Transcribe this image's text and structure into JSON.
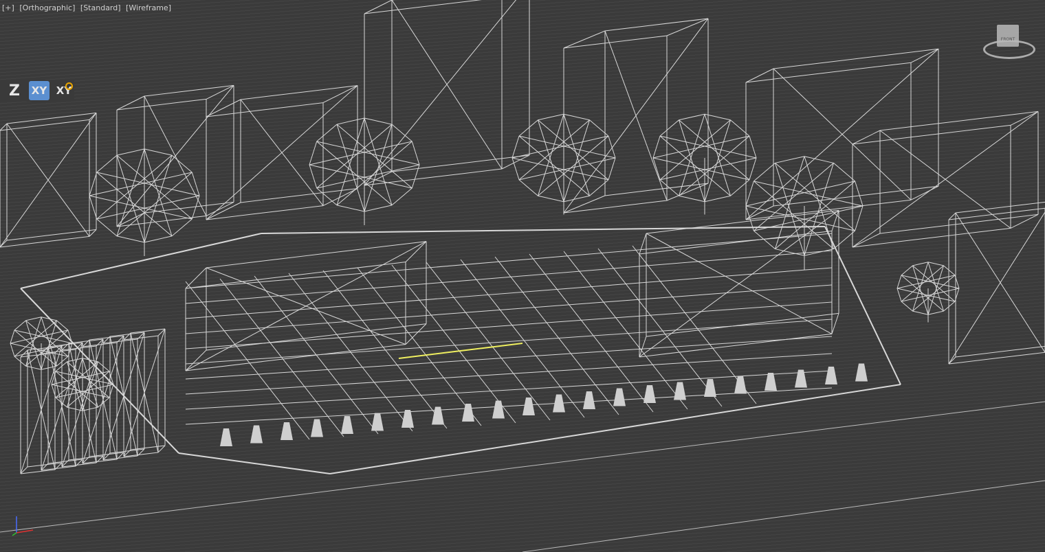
{
  "viewport": {
    "label_items": [
      "[+]",
      "[Orthographic]",
      "[Standard]",
      "[Wireframe]"
    ],
    "constraints": {
      "z": "Z",
      "xy": "XY",
      "xy_lock": "XY"
    },
    "viewcube_face": "FRONT",
    "colors": {
      "wire": "#d8d8d8",
      "selected": "#f0f060",
      "active": "#5b8fd0"
    }
  }
}
